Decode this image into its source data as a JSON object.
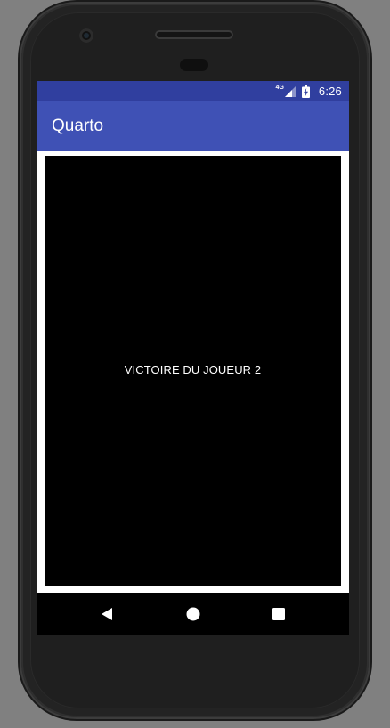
{
  "status_bar": {
    "network_type": "4G",
    "time": "6:26",
    "icons": [
      "signal-icon",
      "battery-charging-icon"
    ]
  },
  "app_bar": {
    "title": "Quarto"
  },
  "game": {
    "message": "VICTOIRE DU JOUEUR 2"
  },
  "nav_bar": {
    "buttons": [
      "back-icon",
      "home-icon",
      "recents-icon"
    ]
  },
  "colors": {
    "status_bar": "#303f9f",
    "app_bar": "#3f51b5",
    "game_background": "#000000",
    "frame": "#ffffff"
  }
}
